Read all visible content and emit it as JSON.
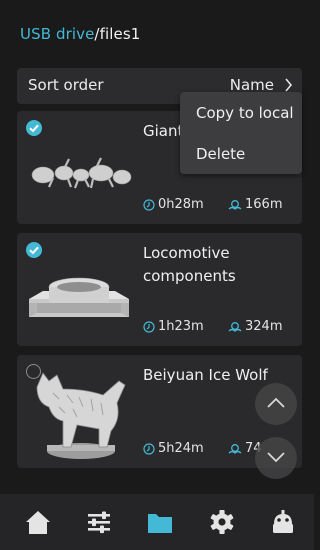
{
  "breadcrumb": {
    "root": "USB drive",
    "separator": "/",
    "current": "files1"
  },
  "sort": {
    "label": "Sort order",
    "value": "Name"
  },
  "context_menu": {
    "items": [
      "Copy to local",
      "Delete"
    ]
  },
  "files": [
    {
      "name": "Giant",
      "time": "0h28m",
      "size": "166m",
      "selected": true,
      "thumb": "ant-model-thumbnail"
    },
    {
      "name": "Locomotive components",
      "time": "1h23m",
      "size": "324m",
      "selected": true,
      "thumb": "ring-part-thumbnail"
    },
    {
      "name": "Beiyuan Ice Wolf",
      "time": "5h24m",
      "size": "74",
      "selected": false,
      "thumb": "wolf-model-thumbnail"
    }
  ],
  "nav": {
    "items": [
      "home-icon",
      "sliders-icon",
      "folder-icon",
      "gear-icon",
      "robot-icon"
    ],
    "active": "folder-icon"
  },
  "colors": {
    "accent": "#43b9d6",
    "background": "#1a1a1b",
    "card": "#2a2a2c",
    "menu": "#3d3d3f"
  }
}
